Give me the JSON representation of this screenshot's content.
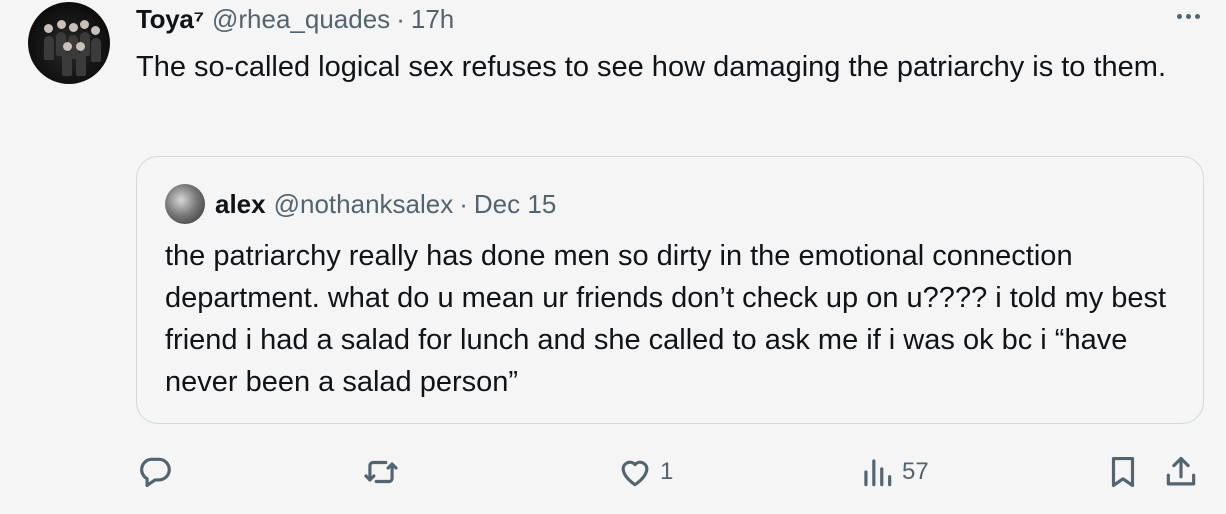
{
  "tweet": {
    "author_name": "Toya⁷",
    "author_handle": "@rhea_quades",
    "separator": "·",
    "time": "17h",
    "text": "The so-called logical sex refuses to see how damaging the patriarchy is to them."
  },
  "quote": {
    "author_name": "alex",
    "author_handle": "@nothanksalex",
    "separator": "·",
    "date": "Dec 15",
    "text": "the patriarchy really has done men so dirty in the emotional connection department. what do u mean ur friends don’t check up on u???? i told my best friend i had a salad for lunch and she called to ask me if i was ok bc i “have never been a salad person”"
  },
  "actions": {
    "reply_icon": "reply-icon",
    "retweet_icon": "retweet-icon",
    "like_icon": "heart-icon",
    "like_count": "1",
    "views_icon": "views-icon",
    "views_count": "57",
    "bookmark_icon": "bookmark-icon",
    "share_icon": "share-icon"
  },
  "colors": {
    "text_primary": "#0f1419",
    "text_secondary": "#536471",
    "border": "#cfd9de",
    "background": "#f5f5f5"
  }
}
